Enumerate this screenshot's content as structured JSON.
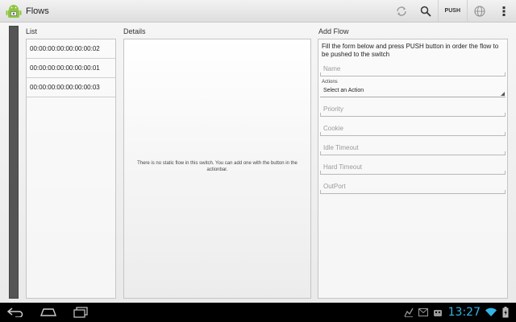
{
  "app": {
    "title": "Flows"
  },
  "actionbar": {
    "push_label": "PUSH"
  },
  "columns": {
    "list": "List",
    "details": "Details",
    "add_flow": "Add Flow"
  },
  "list": {
    "items": [
      "00:00:00:00:00:00:00:02",
      "00:00:00:00:00:00:00:01",
      "00:00:00:00:00:00:00:03"
    ]
  },
  "details": {
    "empty_message": "There is no static flow in this switch. You can add one with the button in the actionbar."
  },
  "form": {
    "intro": "Fill the form below and press PUSH button in order the flow to be pushed to the switch",
    "name_placeholder": "Name",
    "actions_label": "Actions",
    "actions_selected": "Select an Action",
    "priority_placeholder": "Priority",
    "cookie_placeholder": "Cookie",
    "idle_timeout_placeholder": "Idle Timeout",
    "hard_timeout_placeholder": "Hard Timeout",
    "outport_placeholder": "OutPort"
  },
  "statusbar": {
    "time": "13:27"
  },
  "colors": {
    "accent": "#33b5e5",
    "navbar": "#000000"
  }
}
